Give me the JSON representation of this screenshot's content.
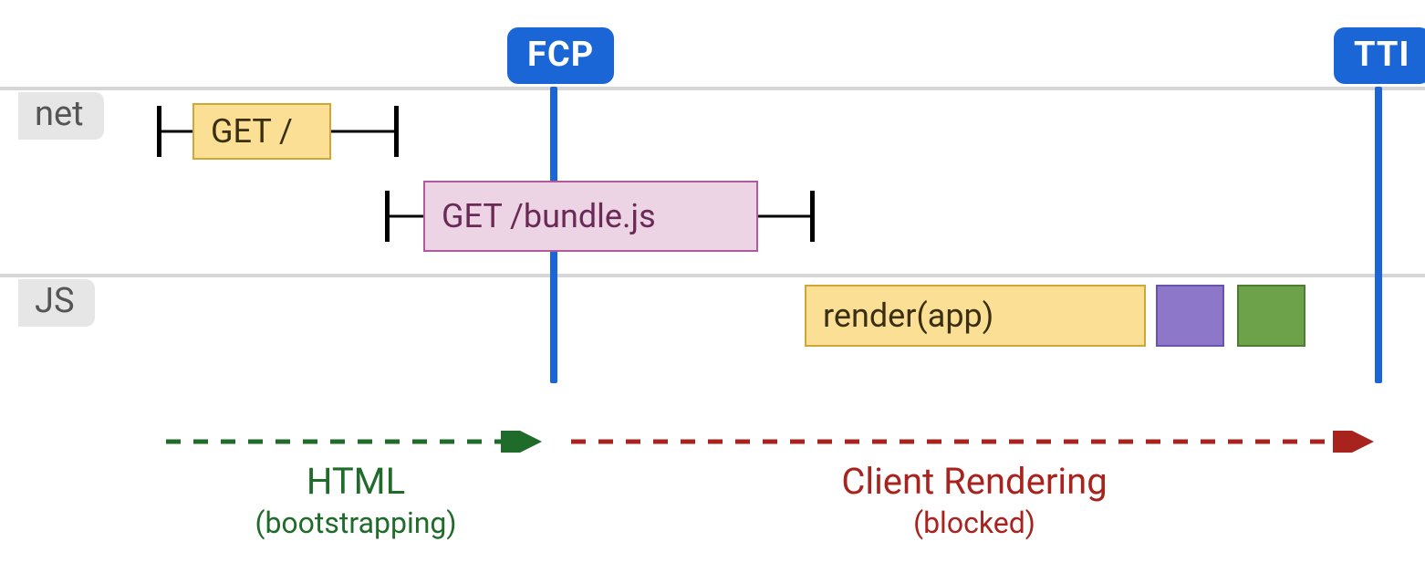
{
  "labels": {
    "row_net": "net",
    "row_js": "JS"
  },
  "milestones": {
    "fcp": "FCP",
    "tti": "TTI"
  },
  "net": {
    "get_root": "GET /",
    "get_bundle": "GET /bundle.js"
  },
  "js": {
    "render_app": "render(app)"
  },
  "phases": {
    "html_title": "HTML",
    "html_sub": "(bootstrapping)",
    "client_title": "Client Rendering",
    "client_sub": "(blocked)"
  },
  "colors": {
    "blue": "#1a66d6",
    "yellow_fill": "#fadf94",
    "yellow_border": "#d1a536",
    "pink_fill": "#ecd4e5",
    "pink_border": "#b05b9e",
    "purple_fill": "#8c77c9",
    "purple_border": "#6a52b1",
    "green_fill": "#6da24a",
    "green_border": "#4f7c35",
    "darkgreen": "#1f6b2a",
    "darkred": "#a9231e"
  },
  "chart_data": {
    "type": "timeline",
    "title": "Client-side rendering timeline",
    "x_unit": "relative",
    "x_range": [
      0,
      100
    ],
    "milestones": [
      {
        "name": "FCP",
        "x": 38.8
      },
      {
        "name": "TTI",
        "x": 96.7
      }
    ],
    "tracks": [
      {
        "name": "net",
        "items": [
          {
            "label": "GET /",
            "whisker_start": 11.0,
            "box_start": 13.5,
            "box_end": 23.2,
            "whisker_end": 28.0,
            "color": "yellow"
          },
          {
            "label": "GET /bundle.js",
            "whisker_start": 27.0,
            "box_start": 29.7,
            "box_end": 53.2,
            "whisker_end": 57.2,
            "color": "pink"
          }
        ]
      },
      {
        "name": "JS",
        "items": [
          {
            "label": "render(app)",
            "box_start": 56.5,
            "box_end": 80.5,
            "color": "yellow"
          },
          {
            "label": "",
            "box_start": 81.1,
            "box_end": 85.9,
            "color": "purple"
          },
          {
            "label": "",
            "box_start": 86.8,
            "box_end": 91.6,
            "color": "green"
          }
        ]
      }
    ],
    "phases": [
      {
        "title": "HTML",
        "subtitle": "(bootstrapping)",
        "start": 11.5,
        "end": 38.5,
        "color": "darkgreen"
      },
      {
        "title": "Client Rendering",
        "subtitle": "(blocked)",
        "start": 40.0,
        "end": 96.5,
        "color": "darkred"
      }
    ]
  }
}
